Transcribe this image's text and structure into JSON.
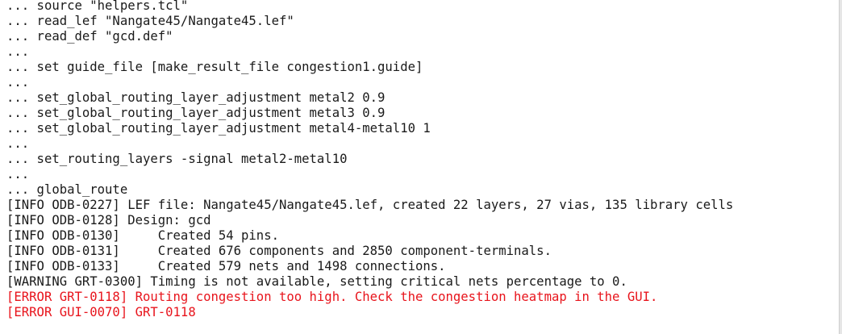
{
  "terminal": {
    "colors": {
      "background": "#ffffff",
      "text": "#1a1a1a",
      "error": "#e8141c"
    },
    "lines": [
      {
        "text": "... source \"helpers.tcl\"",
        "type": "normal"
      },
      {
        "text": "... read_lef \"Nangate45/Nangate45.lef\"",
        "type": "normal"
      },
      {
        "text": "... read_def \"gcd.def\"",
        "type": "normal"
      },
      {
        "text": "...",
        "type": "normal"
      },
      {
        "text": "... set guide_file [make_result_file congestion1.guide]",
        "type": "normal"
      },
      {
        "text": "...",
        "type": "normal"
      },
      {
        "text": "... set_global_routing_layer_adjustment metal2 0.9",
        "type": "normal"
      },
      {
        "text": "... set_global_routing_layer_adjustment metal3 0.9",
        "type": "normal"
      },
      {
        "text": "... set_global_routing_layer_adjustment metal4-metal10 1",
        "type": "normal"
      },
      {
        "text": "...",
        "type": "normal"
      },
      {
        "text": "... set_routing_layers -signal metal2-metal10",
        "type": "normal"
      },
      {
        "text": "...",
        "type": "normal"
      },
      {
        "text": "... global_route",
        "type": "normal"
      },
      {
        "text": "[INFO ODB-0227] LEF file: Nangate45/Nangate45.lef, created 22 layers, 27 vias, 135 library cells",
        "type": "normal"
      },
      {
        "text": "[INFO ODB-0128] Design: gcd",
        "type": "normal"
      },
      {
        "text": "[INFO ODB-0130]     Created 54 pins.",
        "type": "normal"
      },
      {
        "text": "[INFO ODB-0131]     Created 676 components and 2850 component-terminals.",
        "type": "normal"
      },
      {
        "text": "[INFO ODB-0133]     Created 579 nets and 1498 connections.",
        "type": "normal"
      },
      {
        "text": "[WARNING GRT-0300] Timing is not available, setting critical nets percentage to 0.",
        "type": "normal"
      },
      {
        "text": "[ERROR GRT-0118] Routing congestion too high. Check the congestion heatmap in the GUI.",
        "type": "error"
      },
      {
        "text": "[ERROR GUI-0070] GRT-0118",
        "type": "error"
      }
    ]
  }
}
